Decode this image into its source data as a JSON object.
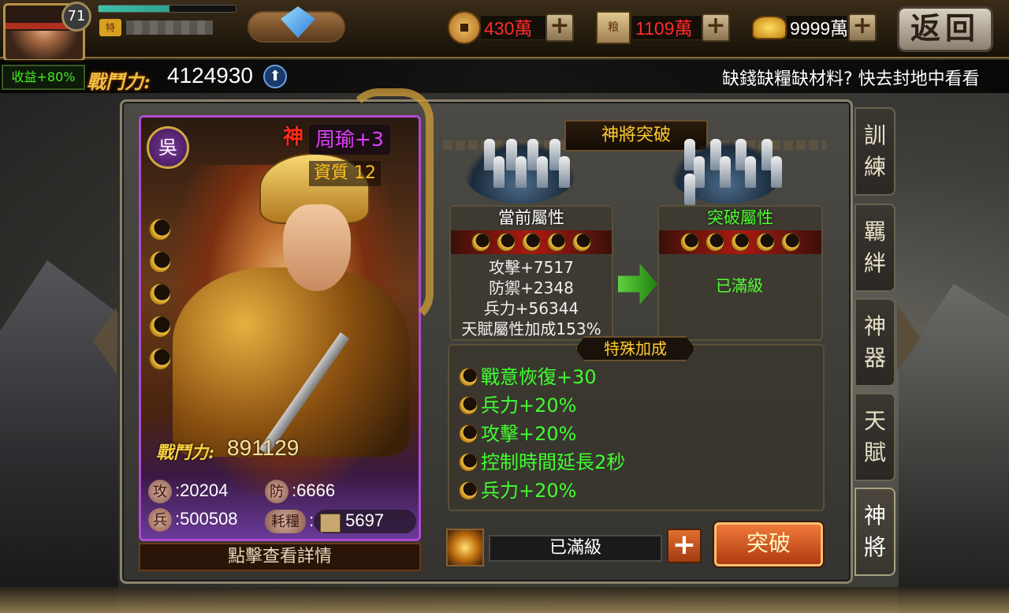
{
  "player": {
    "level": "71",
    "vip_label": "特",
    "xp_fraction": 0.52,
    "income_bonus": "收益+80%",
    "power_label": "戰鬥力:",
    "power_value": "4124930"
  },
  "resources": {
    "copper": "430萬",
    "grain": "1109萬",
    "gold": "9999萬",
    "grain_icon_text": "粮"
  },
  "back_label": "返回",
  "marquee": "缺錢缺糧缺材料? 快去封地中看看",
  "hero": {
    "faction": "吳",
    "tier": "神",
    "name": "周瑜+3",
    "aptitude": "資質 12",
    "power_label": "戰鬥力:",
    "power_value": "891129",
    "stats": {
      "attack_label": "攻",
      "attack_value": "20204",
      "defense_label": "防",
      "defense_value": "6666",
      "troops_label": "兵",
      "troops_value": "500508",
      "ration_label": "耗糧",
      "ration_value": "5697"
    },
    "detail_label": "點擊查看詳情",
    "moon_count": 5
  },
  "breakthrough": {
    "title": "神將突破",
    "current_header": "當前屬性",
    "next_header": "突破屬性",
    "current_attrs": [
      "攻擊+7517",
      "防禦+2348",
      "兵力+56344",
      "天賦屬性加成153%"
    ],
    "next_status": "已滿級",
    "special_title": "特殊加成",
    "special_bonuses": [
      "戰意恢復+30",
      "兵力+20%",
      "攻擊+20%",
      "控制時間延長2秒",
      "兵力+20%"
    ],
    "max_label": "已滿級",
    "break_button": "突破"
  },
  "side_tabs": [
    {
      "label": "訓練"
    },
    {
      "label": "羈絆"
    },
    {
      "label": "神器"
    },
    {
      "label": "天賦"
    },
    {
      "label": "神將"
    }
  ],
  "colors": {
    "accent_gold": "#ffcc30",
    "bonus_green": "#40ff30",
    "resource_red": "#ff2a2a",
    "hero_name_purple": "#e040ff"
  }
}
